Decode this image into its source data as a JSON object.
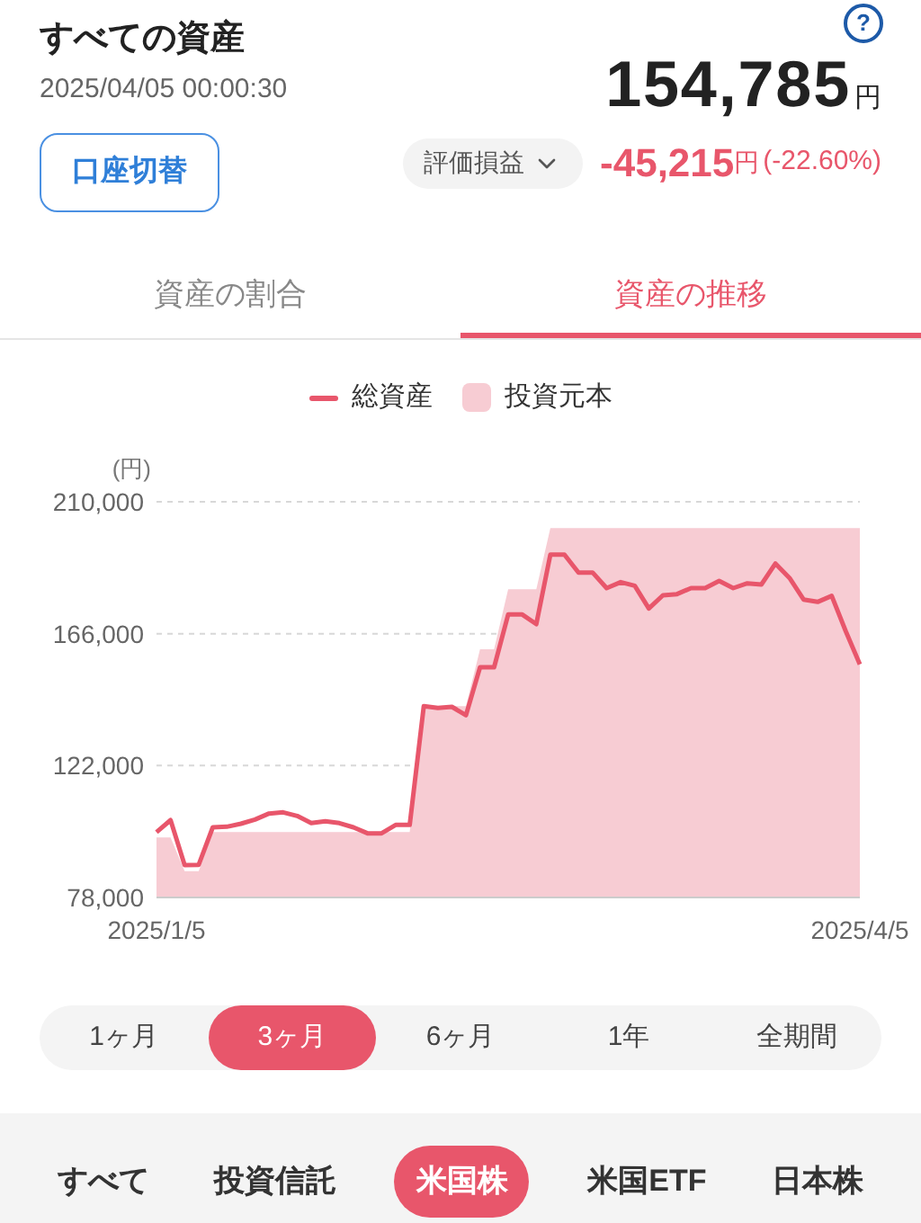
{
  "header": {
    "title": "すべての資産",
    "timestamp": "2025/04/05 00:00:30",
    "help": "?",
    "total": "154,785",
    "total_unit": "円",
    "account_button": "口座切替",
    "metric_dropdown": "評価損益",
    "change": "-45,215",
    "change_unit": "円",
    "change_pct": "(-22.60%)"
  },
  "tabs": [
    {
      "label": "資産の割合",
      "selected": false
    },
    {
      "label": "資産の推移",
      "selected": true
    }
  ],
  "chart": {
    "chart_data": {
      "type": "line",
      "legend": "top",
      "ylabel": "(円)",
      "categories": [
        "2025/1/5",
        null,
        null,
        null,
        null,
        null,
        null,
        null,
        null,
        null,
        null,
        null,
        null,
        null,
        null,
        null,
        null,
        null,
        null,
        null,
        null,
        null,
        null,
        null,
        null,
        null,
        null,
        null,
        null,
        null,
        null,
        null,
        null,
        null,
        null,
        null,
        null,
        null,
        null,
        null,
        null,
        null,
        null,
        null,
        null,
        null,
        null,
        null,
        null,
        null,
        "2025/4/5"
      ],
      "series": [
        {
          "name": "総資産",
          "color": "#e8566b",
          "values": [
            99800,
            103800,
            88800,
            88900,
            101400,
            101600,
            102600,
            104000,
            106000,
            106400,
            105200,
            102800,
            103400,
            102800,
            101400,
            99400,
            99400,
            102200,
            102200,
            141800,
            141200,
            141600,
            138800,
            154800,
            154800,
            172400,
            172400,
            169200,
            192400,
            192400,
            186400,
            186400,
            181200,
            183200,
            182000,
            174400,
            178800,
            179200,
            181200,
            181200,
            183600,
            181200,
            182800,
            182400,
            189400,
            184600,
            177400,
            176600,
            178600,
            166800,
            155800
          ]
        },
        {
          "name": "投資元本",
          "type": "area",
          "color": "#f7ccd3",
          "values": [
            98000,
            98000,
            86800,
            86800,
            99800,
            99800,
            99800,
            99800,
            99800,
            99800,
            99800,
            99800,
            99800,
            99800,
            99800,
            99800,
            99800,
            99800,
            99800,
            141800,
            141800,
            141800,
            141800,
            160800,
            160800,
            180800,
            180800,
            180800,
            201200,
            201200,
            201200,
            201200,
            201200,
            201200,
            201200,
            201200,
            201200,
            201200,
            201200,
            201200,
            201200,
            201200,
            201200,
            201200,
            201200,
            201200,
            201200,
            201200,
            201200,
            201200,
            201200
          ]
        }
      ],
      "ylim": [
        78000,
        210000
      ],
      "yticks": [
        {
          "value": 78000,
          "label": "78,000"
        },
        {
          "value": 122000,
          "label": "122,000"
        },
        {
          "value": 166000,
          "label": "166,000"
        },
        {
          "value": 210000,
          "label": "210,000"
        }
      ]
    }
  },
  "periods": [
    {
      "label": "1ヶ月",
      "selected": false
    },
    {
      "label": "3ヶ月",
      "selected": true
    },
    {
      "label": "6ヶ月",
      "selected": false
    },
    {
      "label": "1年",
      "selected": false
    },
    {
      "label": "全期間",
      "selected": false
    }
  ],
  "categories": [
    {
      "label": "すべて",
      "selected": false
    },
    {
      "label": "投資信託",
      "selected": false
    },
    {
      "label": "米国株",
      "selected": true
    },
    {
      "label": "米国ETF",
      "selected": false
    },
    {
      "label": "日本株",
      "selected": false
    }
  ]
}
